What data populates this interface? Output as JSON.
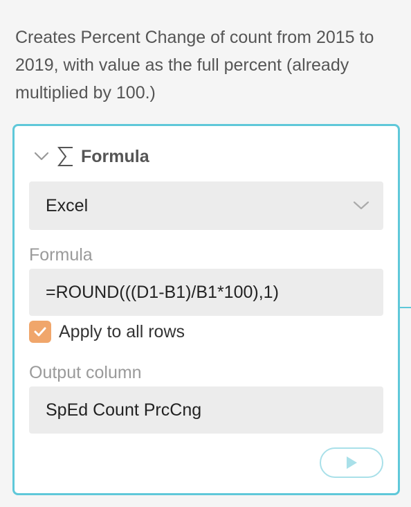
{
  "description": "Creates Percent Change of count from 2015 to 2019, with value as the full percent (already multiplied by 100.)",
  "step": {
    "title": "Formula",
    "collapse_icon": "chevron-down-icon",
    "type_icon": "sigma-icon",
    "language_select": {
      "value": "Excel"
    },
    "formula_field": {
      "label": "Formula",
      "value": "=ROUND(((D1-B1)/B1*100),1)"
    },
    "apply_all_rows": {
      "label": "Apply to all rows",
      "checked": true
    },
    "output_column": {
      "label": "Output column",
      "value": "SpEd Count PrcCng"
    },
    "run_button_icon": "play-icon"
  },
  "colors": {
    "accent": "#5fc8d9",
    "checkbox": "#f0a66b",
    "field_bg": "#ececec",
    "label": "#9a9a9a"
  }
}
